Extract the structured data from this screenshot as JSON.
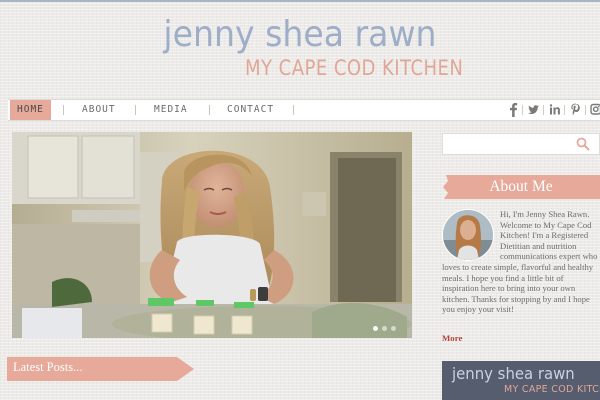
{
  "header": {
    "title": "jenny shea rawn",
    "subtitle": "MY CAPE COD KITCHEN"
  },
  "nav": {
    "items": [
      {
        "label": "HOME",
        "active": true
      },
      {
        "label": "ABOUT",
        "active": false
      },
      {
        "label": "MEDIA",
        "active": false
      },
      {
        "label": "CONTACT",
        "active": false
      }
    ],
    "social": [
      "facebook-icon",
      "twitter-icon",
      "linkedin-icon",
      "pinterest-icon",
      "instagram-icon"
    ]
  },
  "hero": {
    "slides_total": 3,
    "active_slide": 1
  },
  "latest_posts": {
    "label": "Latest Posts..."
  },
  "sidebar": {
    "search_placeholder": "",
    "about_title": "About Me",
    "about_text": "Hi, I'm Jenny Shea Rawn. Welcome to My Cape Cod Kitchen! I'm a Registered Dietitian and nutrition communications expert who loves to create simple, flavorful and healthy meals. I hope you find a little bit of inspiration here to bring into your own kitchen. Thanks for stopping by and I hope you enjoy your visit!",
    "more_label": "More",
    "badge_name": "jenny shea rawn",
    "badge_sub": "MY CAPE COD KITCHEN"
  },
  "colors": {
    "title_blue": "#9eadc8",
    "accent_salmon": "#e6a99a",
    "more_red": "#b5443a",
    "badge_slate": "#555d6f"
  }
}
